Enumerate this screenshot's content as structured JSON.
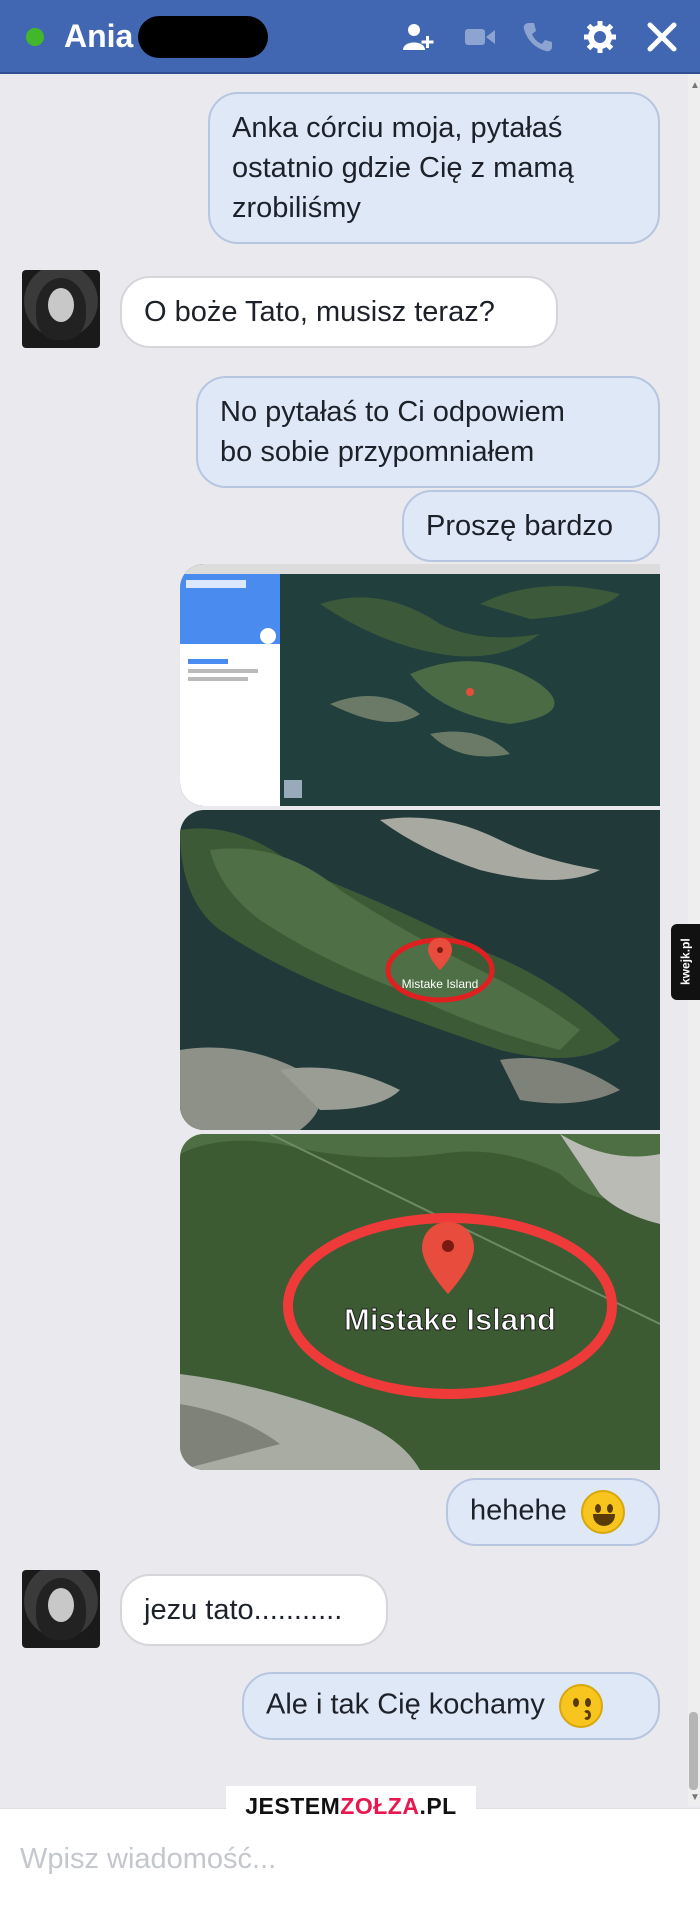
{
  "header": {
    "contact_name": "Ania",
    "icons": [
      "add-person-icon",
      "video-call-icon",
      "phone-icon",
      "gear-icon",
      "close-icon"
    ],
    "accent_color": "#4267b2"
  },
  "messages": [
    {
      "side": "out",
      "text_lines": [
        "Anka córciu moja, pytałaś",
        "ostatnio gdzie Cię z mamą",
        "zrobiliśmy"
      ]
    },
    {
      "side": "in",
      "text": "O boże Tato, musisz teraz?"
    },
    {
      "side": "out",
      "text_lines": [
        "No pytałaś to Ci odpowiem",
        "bo sobie przypomniałem"
      ]
    },
    {
      "side": "out",
      "text": "Proszę bardzo"
    },
    {
      "side": "out",
      "type": "image",
      "image_label": ""
    },
    {
      "side": "out",
      "type": "image",
      "image_label": "Mistake Island"
    },
    {
      "side": "out",
      "type": "image",
      "image_label": "Mistake Island"
    },
    {
      "side": "out",
      "text": "hehehe",
      "emoji": "grinning-face-icon"
    },
    {
      "side": "in",
      "text": "jezu tato..........."
    },
    {
      "side": "out",
      "text": "Ale i tak Cię kochamy",
      "emoji": "kissing-face-icon"
    }
  ],
  "watermarks": {
    "side_badge": "kwejk.pl",
    "bottom_part1": "JESTEM",
    "bottom_part2": "ZOŁZA",
    "bottom_part3": ".PL"
  },
  "composer": {
    "placeholder": "Wpisz wiadomość..."
  }
}
